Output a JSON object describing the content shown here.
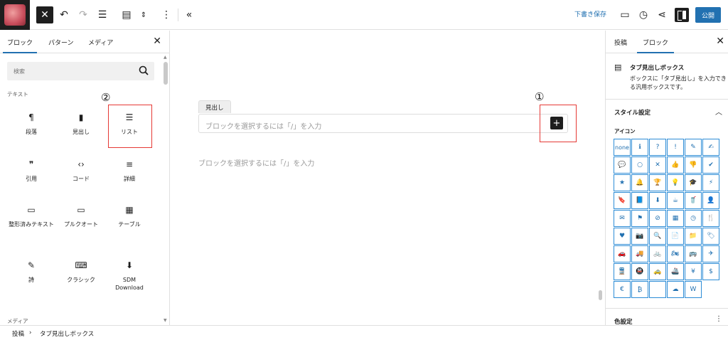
{
  "toolbar": {
    "save_draft": "下書き保存",
    "publish": "公開"
  },
  "inserter": {
    "tabs": [
      "ブロック",
      "パターン",
      "メディア"
    ],
    "search_placeholder": "検索",
    "category_text": "テキスト",
    "category_media": "メディア",
    "blocks": [
      {
        "label": "段落",
        "icon": "¶"
      },
      {
        "label": "見出し",
        "icon": "▮"
      },
      {
        "label": "リスト",
        "icon": "☰"
      },
      {
        "label": "引用",
        "icon": "❞"
      },
      {
        "label": "コード",
        "icon": "‹›"
      },
      {
        "label": "詳細",
        "icon": "≡"
      },
      {
        "label": "整形済みテキスト",
        "icon": "▭"
      },
      {
        "label": "プルクオート",
        "icon": "▭"
      },
      {
        "label": "テーブル",
        "icon": "▦"
      },
      {
        "label": "詩",
        "icon": "✎"
      },
      {
        "label": "クラシック",
        "icon": "⌨"
      },
      {
        "label": "SDM Download",
        "icon": "⬇"
      }
    ],
    "marker_2": "②"
  },
  "canvas": {
    "tab_label": "見出し",
    "tab_placeholder": "ブロックを選択するには「/」を入力",
    "paragraph_placeholder": "ブロックを選択するには「/」を入力",
    "marker_1": "①"
  },
  "sidebar": {
    "tabs": [
      "投稿",
      "ブロック"
    ],
    "block_title": "タブ見出しボックス",
    "block_desc": "ボックスに「タブ見出し」を入力できる汎用ボックスです。",
    "style_heading": "スタイル設定",
    "icon_label": "アイコン",
    "icons": [
      "none",
      "ℹ",
      "?",
      "!",
      "✎",
      "✍",
      "💬",
      "○",
      "✕",
      "👍",
      "👎",
      "✔",
      "★",
      "🔔",
      "🏆",
      "💡",
      "🎓",
      "⚡",
      "🔖",
      "📘",
      "⬇",
      "☕",
      "🥤",
      "👤",
      "✉",
      "⚑",
      "⊘",
      "▦",
      "◷",
      "🍴",
      "♥",
      "📷",
      "🔍",
      "📄",
      "📁",
      "🏷",
      "🚗",
      "🚚",
      "🚲",
      "🏍",
      "🚌",
      "✈",
      "🚆",
      "🚇",
      "🚕",
      "🚢",
      "¥",
      "$",
      "€",
      "₿",
      "",
      "☁",
      "W"
    ],
    "color_heading": "色設定"
  },
  "breadcrumb": [
    "投稿",
    "タブ見出しボックス"
  ],
  "colors": {
    "accent": "#2271b1",
    "marker": "#e53935"
  }
}
